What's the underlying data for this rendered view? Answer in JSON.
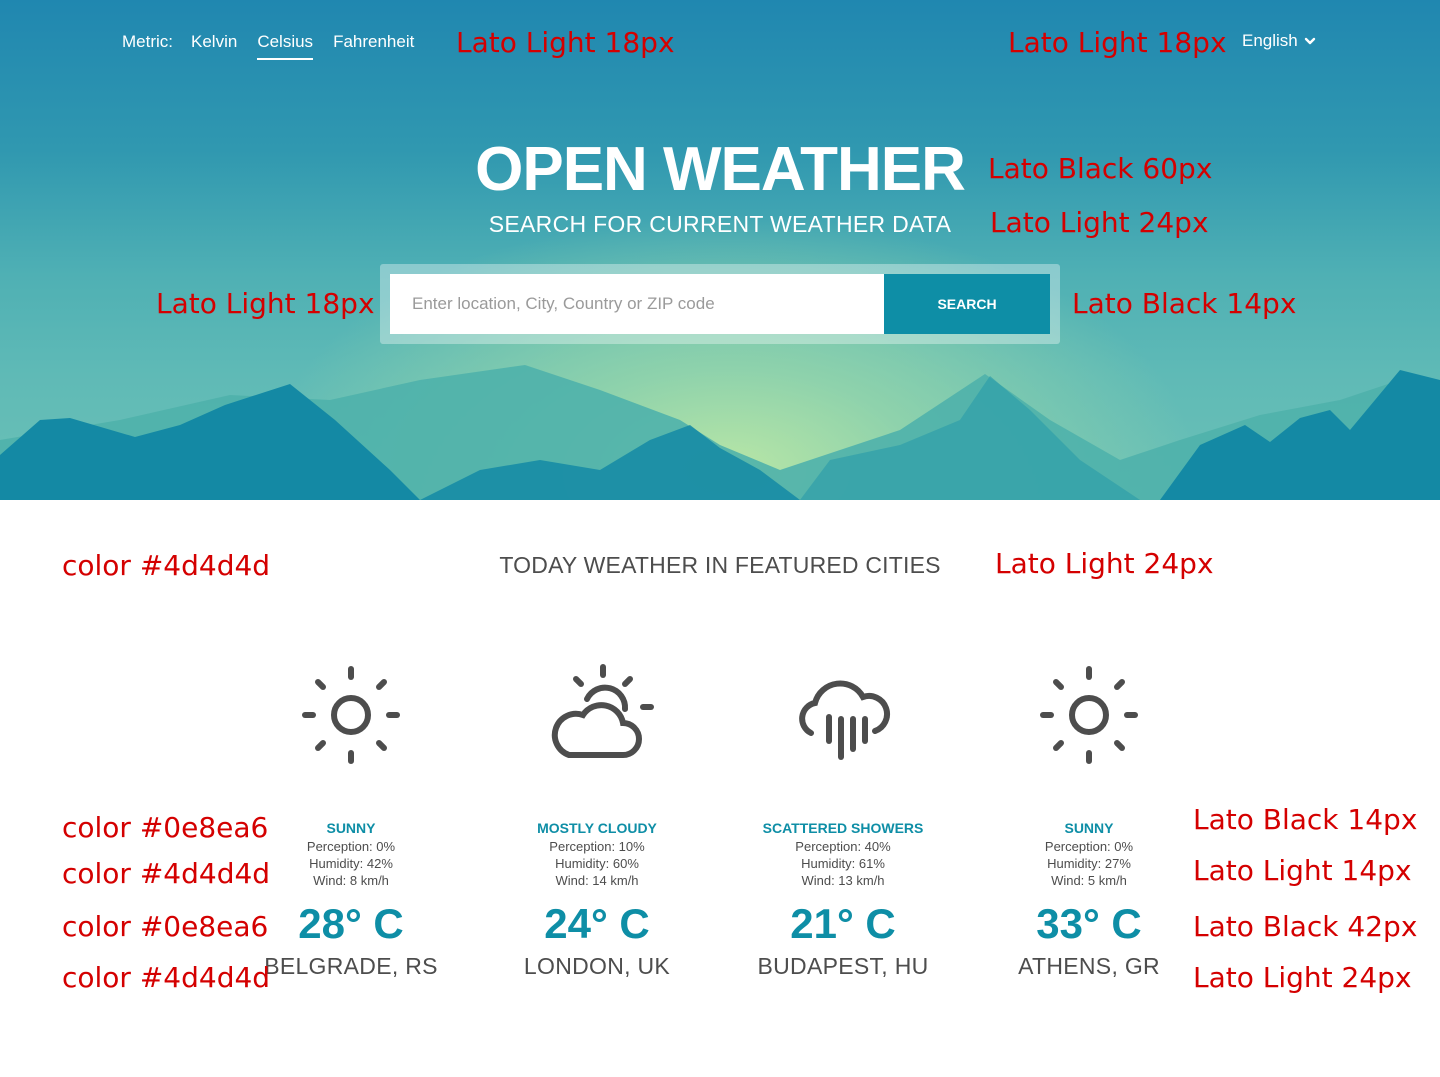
{
  "nav": {
    "metric_label": "Metric:",
    "options": [
      "Kelvin",
      "Celsius",
      "Fahrenheit"
    ],
    "active": "Celsius",
    "language": "English"
  },
  "hero": {
    "title": "OPEN WEATHER",
    "subtitle": "SEARCH FOR CURRENT WEATHER DATA"
  },
  "search": {
    "placeholder": "Enter location, City, Country or ZIP code",
    "value": "",
    "button_label": "SEARCH"
  },
  "featured": {
    "title": "TODAY WEATHER IN FEATURED CITIES",
    "cities": [
      {
        "icon": "sun-icon",
        "condition": "SUNNY",
        "perception": "Perception: 0%",
        "humidity": "Humidity: 42%",
        "wind": "Wind: 8 km/h",
        "temp": "28° C",
        "name": "BELGRADE, RS"
      },
      {
        "icon": "partly-cloudy-icon",
        "condition": "MOSTLY CLOUDY",
        "perception": "Perception: 10%",
        "humidity": "Humidity: 60%",
        "wind": "Wind: 14 km/h",
        "temp": "24° C",
        "name": "LONDON, UK"
      },
      {
        "icon": "rain-cloud-icon",
        "condition": "SCATTERED SHOWERS",
        "perception": "Perception: 40%",
        "humidity": "Humidity: 61%",
        "wind": "Wind: 13 km/h",
        "temp": "21° C",
        "name": "BUDAPEST, HU"
      },
      {
        "icon": "sun-icon",
        "condition": "SUNNY",
        "perception": "Perception: 0%",
        "humidity": "Humidity: 27%",
        "wind": "Wind: 5 km/h",
        "temp": "33° C",
        "name": "ATHENS, GR"
      }
    ]
  },
  "annotations": {
    "nav_left": "Lato Light 18px",
    "nav_right": "Lato Light 18px",
    "title": "Lato Black 60px",
    "subtitle": "Lato Light 24px",
    "search_left": "Lato Light 18px",
    "search_right": "Lato Black 14px",
    "featured_color": "color #4d4d4d",
    "featured_font": "Lato Light 24px",
    "cond_color": "color #0e8ea6",
    "stat_color": "color #4d4d4d",
    "temp_color": "color #0e8ea6",
    "name_color": "color #4d4d4d",
    "cond_font": "Lato Black 14px",
    "stat_font": "Lato Light 14px",
    "temp_font": "Lato Black 42px",
    "name_font": "Lato Light 24px"
  },
  "colors": {
    "accent": "#0e8ea6",
    "text": "#4d4d4d",
    "annotation": "#d40000"
  }
}
